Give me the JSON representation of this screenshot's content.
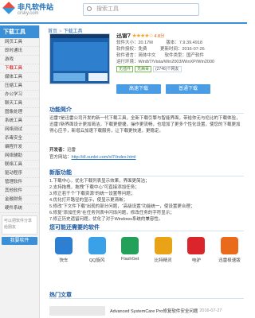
{
  "header": {
    "logo_text": "非凡软件站",
    "logo_sub": "crsky.com",
    "search_placeholder": "搜索工具"
  },
  "sidebar": {
    "title": "下载工具",
    "items": [
      "网页工具",
      "即时通讯",
      "游戏",
      "下载工具",
      "媒体工具",
      "压缩工具",
      "办公学习",
      "聊天工具",
      "图像处理",
      "系统工具",
      "网络测试",
      "杀毒安全",
      "编程开发",
      "网络辅助",
      "联络工具",
      "驱动程序",
      "管理软件",
      "其他软件",
      "金融财务",
      "硬件系统"
    ],
    "active_index": 3,
    "box_text": "可以把软件分享给朋友",
    "button_label": "我要软件"
  },
  "breadcrumb": [
    "首页",
    "下载工具"
  ],
  "app": {
    "name": "迅雷7",
    "stars": "★★★★☆",
    "score": "4.8分",
    "rows": [
      "软件大小：20.17M　　　版本：7.9.39.4918",
      "软件授权：免费　　　更新时间：2016-07-26",
      "软件语言：简体中文　　软件类型：国产软件",
      "运行环境：Win8/7/Vista/Win2003/WinXP/Win2000"
    ],
    "tags": [
      "无插件",
      "无病毒",
      "(2746)个网友"
    ],
    "download_label": "高速下载",
    "normal_download_label": "普通下载"
  },
  "sections": {
    "intro_title": "功能简介",
    "intro_text": "迅雷7是迅雷公司开发的新一代下载工具，全新下载引擎与智能界面，带给你无与伦比的下载体验，迅雷7新界面设计更加简洁，下载更便捷，操作更流畅，也增加了更多个性化设置，使您的下载更加得心应手，新增云加速下载服务，让下载更快速，更稳定。",
    "dev_label": "开发者：",
    "dev_value": "迅雷",
    "site_label": "官方网站：",
    "site_value": "http://dl.xunlei.com/xl7/index.html",
    "steps_title": "新版功能",
    "steps": [
      "1.下载中心，优化下载列表显示效果，界面更简洁；",
      "2.支持拖拽，拖拽“下载中心”可直接添加任务；",
      "3.修正若干个“下载资源”的统一设置等问题；",
      "4.优化打开路径的显示，使显示更清晰；",
      "5.修改“下文件下载”出现的部分问题，“高级设置”功能统一，使设置更合理；",
      "6.修复“添加任务”在任务列表中闪烁问题，修改任务的字符显示；",
      "7.修正历史遗留问题，优化了对于Windows系统的兼容性。"
    ],
    "related_title": "您可能还需要的软件",
    "hot_title": "热门文章"
  },
  "related_apps": [
    {
      "label": "快车",
      "color": "#2d7fd3"
    },
    {
      "label": "QQ旋风",
      "color": "#3aa0e8"
    },
    {
      "label": "FlashGet",
      "color": "#23a05a"
    },
    {
      "label": "比特精灵",
      "color": "#e8a317"
    },
    {
      "label": "电驴",
      "color": "#d9252b"
    },
    {
      "label": "迅雷极速版",
      "color": "#e86a1a"
    }
  ],
  "hot_article": {
    "text": "Advanced SystemCare Pro修复软件安全问题",
    "date": "2016-07-27"
  }
}
